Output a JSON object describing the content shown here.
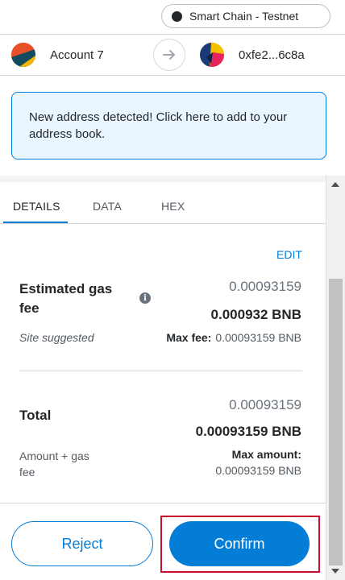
{
  "network": {
    "name": "Smart Chain - Testnet"
  },
  "sender": {
    "name": "Account 7"
  },
  "recipient": {
    "address": "0xfe2...6c8a"
  },
  "notice": {
    "text": "New address detected! Click here to add to your address book."
  },
  "tabs": [
    {
      "label": "DETAILS",
      "active": true
    },
    {
      "label": "DATA",
      "active": false
    },
    {
      "label": "HEX",
      "active": false
    }
  ],
  "details": {
    "edit_label": "EDIT",
    "gas": {
      "label": "Estimated gas fee",
      "primary": "0.00093159",
      "secondary": "0.000932 BNB",
      "subtitle": "Site suggested",
      "max_fee_label": "Max fee:",
      "max_fee_value": "0.00093159 BNB"
    },
    "total": {
      "label": "Total",
      "primary": "0.00093159",
      "secondary": "0.00093159 BNB",
      "subtitle": "Amount + gas fee",
      "max_amount_label": "Max amount:",
      "max_amount_value": "0.00093159 BNB"
    }
  },
  "footer": {
    "reject_label": "Reject",
    "confirm_label": "Confirm"
  },
  "colors": {
    "accent": "#037dd6",
    "highlight": "#c8102e",
    "notice_bg": "#eaf6ff"
  },
  "icons": {
    "network": "network-status-dot",
    "arrow": "arrow-right-icon",
    "info": "info-icon"
  }
}
